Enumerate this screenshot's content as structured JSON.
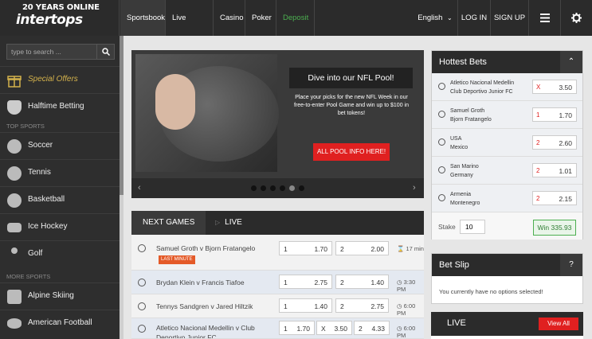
{
  "header": {
    "logo_top": "20 YEARS ONLINE",
    "logo_main": "intertops",
    "nav": [
      "Sportsbook",
      "Live Betting",
      "Casino",
      "Poker",
      "Deposit"
    ],
    "language": "English",
    "login": "LOG IN",
    "signup": "SIGN UP",
    "menu_icon": "hamburger-icon",
    "settings_icon": "gear-icon"
  },
  "sidebar": {
    "search_placeholder": "type to search ...",
    "special_offers": "Special Offers",
    "halftime": "Halftime Betting",
    "top_sports_label": "TOP SPORTS",
    "top_sports": [
      "Soccer",
      "Tennis",
      "Basketball",
      "Ice Hockey",
      "Golf"
    ],
    "more_sports_label": "MORE SPORTS",
    "more_sports": [
      "Alpine Skiing",
      "American Football"
    ]
  },
  "banner": {
    "title": "Dive into our NFL Pool!",
    "text": "Place your picks for the new NFL Week in our free-to-enter Pool Game and win up to $100 in bet tokens!",
    "button": "ALL POOL INFO HERE!"
  },
  "events": {
    "tabs": [
      "NEXT GAMES",
      "LIVE"
    ],
    "rows": [
      {
        "name": "Samuel Groth v Bjorn Fratangelo",
        "badge": "LAST MINUTE",
        "o1l": "1",
        "o1": "1.70",
        "o2l": "2",
        "o2": "2.00",
        "time": "17 min"
      },
      {
        "name": "Brydan Klein v Francis Tiafoe",
        "o1l": "1",
        "o1": "2.75",
        "o2l": "2",
        "o2": "1.40",
        "time": "3:30 PM"
      },
      {
        "name": "Tennys Sandgren v Jared Hiltzik",
        "o1l": "1",
        "o1": "1.40",
        "o2l": "2",
        "o2": "2.75",
        "time": "6:00 PM"
      },
      {
        "name": "Atletico Nacional Medellin v Club Deportivo Junior FC",
        "o1l": "1",
        "o1": "1.70",
        "oxl": "X",
        "ox": "3.50",
        "o2l": "2",
        "o2": "4.33",
        "time": "6:00 PM"
      }
    ]
  },
  "hottest": {
    "title": "Hottest Bets",
    "rows": [
      {
        "line1": "Atletico Nacional Medellin",
        "line2": "Club Deportivo Junior FC",
        "sel": "X",
        "odd": "3.50"
      },
      {
        "line1": "Samuel Groth",
        "line2": "Bjorn Fratangelo",
        "sel": "1",
        "odd": "1.70"
      },
      {
        "line1": "USA",
        "line2": "Mexico",
        "sel": "2",
        "odd": "2.60"
      },
      {
        "line1": "San Marino",
        "line2": "Germany",
        "sel": "2",
        "odd": "1.01"
      },
      {
        "line1": "Armenia",
        "line2": "Montenegro",
        "sel": "2",
        "odd": "2.15"
      }
    ],
    "stake_label": "Stake",
    "stake_value": "10",
    "win": "Win 335.93"
  },
  "betslip": {
    "title": "Bet Slip",
    "help": "?",
    "message": "You currently have no options selected!"
  },
  "live": {
    "title": "LIVE",
    "view_all": "View All"
  }
}
